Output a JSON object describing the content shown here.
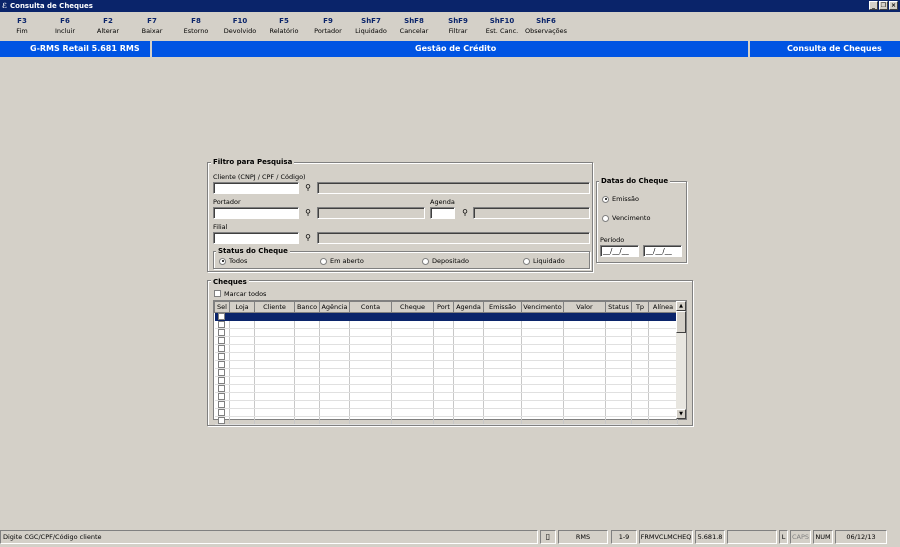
{
  "window": {
    "title": "Consulta de Cheques"
  },
  "toolbar": [
    {
      "key": "F3",
      "label": "Fim"
    },
    {
      "key": "F6",
      "label": "Incluir"
    },
    {
      "key": "F2",
      "label": "Alterar"
    },
    {
      "key": "F7",
      "label": "Baixar"
    },
    {
      "key": "F8",
      "label": "Estorno"
    },
    {
      "key": "F10",
      "label": "Devolvido"
    },
    {
      "key": "F5",
      "label": "Relatório"
    },
    {
      "key": "F9",
      "label": "Portador"
    },
    {
      "key": "ShF7",
      "label": "Liquidado"
    },
    {
      "key": "ShF8",
      "label": "Cancelar"
    },
    {
      "key": "ShF9",
      "label": "Filtrar"
    },
    {
      "key": "ShF10",
      "label": "Est. Canc."
    },
    {
      "key": "ShF6",
      "label": "Observações"
    }
  ],
  "header": {
    "left": "G-RMS Retail 5.681 RMS",
    "center": "Gestão de Crédito",
    "right": "Consulta de Cheques"
  },
  "filtro": {
    "title": "Filtro para Pesquisa",
    "cliente_label": "Cliente (CNPJ / CPF / Código)",
    "portador_label": "Portador",
    "agenda_label": "Agenda",
    "filial_label": "Filial",
    "status_title": "Status do Cheque",
    "status_options": [
      "Todos",
      "Em aberto",
      "Depositado",
      "Liquidado"
    ],
    "status_selected": "Todos"
  },
  "datas": {
    "title": "Datas do Cheque",
    "options": [
      "Emissão",
      "Vencimento"
    ],
    "selected": "Emissão",
    "periodo_label": "Período",
    "data_inicio": "__/__/__",
    "data_fim": "__/__/__"
  },
  "cheques": {
    "title": "Cheques",
    "marcar_todos": "Marcar todos",
    "columns": [
      "Sel",
      "Loja",
      "Cliente",
      "Banco",
      "Agência",
      "Conta",
      "Cheque",
      "Port",
      "Agenda",
      "Emissão",
      "Vencimento",
      "Valor",
      "Status",
      "Tp",
      "Alínea"
    ],
    "row_count": 14
  },
  "statusbar": {
    "message": "Digite CGC/CPF/Código cliente",
    "user": "RMS",
    "record": "1-9",
    "form": "FRMVCLMCHEQ",
    "version": "5.681.8",
    "l": "L",
    "caps": "CAPS",
    "num": "NUM",
    "date": "06/12/13"
  },
  "icons": {
    "app": "app-icon",
    "search": "binoculars-icon",
    "minimize": "minimize-icon",
    "restore": "restore-icon",
    "close": "close-icon",
    "doc": "document-icon"
  }
}
